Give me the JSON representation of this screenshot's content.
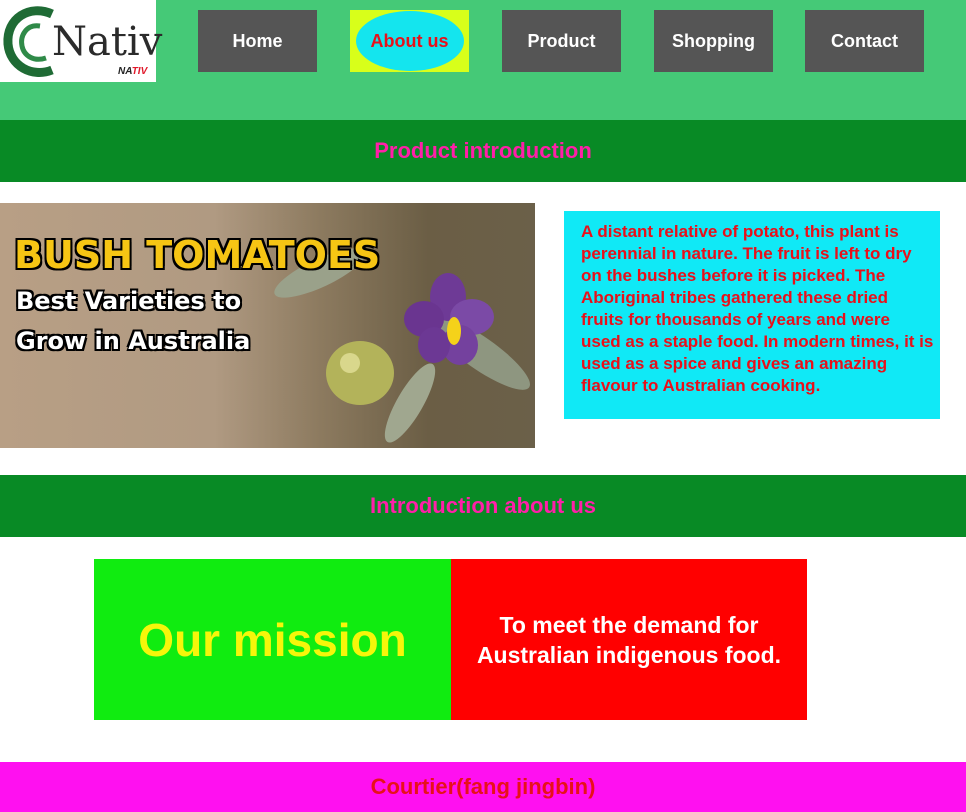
{
  "logo": {
    "brand": "Nativ",
    "sub_prefix": "NA",
    "sub_suffix": "TIV"
  },
  "nav": {
    "home": "Home",
    "about": "About us",
    "product": "Product",
    "shopping": "Shopping",
    "contact": "Contact"
  },
  "sections": {
    "product_intro": "Product introduction",
    "about_intro": "Introduction about us"
  },
  "hero": {
    "title": "BUSH TOMATOES",
    "line1": "Best Varieties to",
    "line2": "Grow in Australia"
  },
  "description": "A distant relative of potato, this plant is perennial in nature. The fruit is left to dry on the bushes before it is picked. The Aboriginal tribes gathered these dried fruits for thousands of years and were used as a staple food. In modern times, it is used as a spice and gives an amazing flavour to Australian cooking.",
  "mission": {
    "heading": "Our mission",
    "text": "To meet the demand for Australian indigenous food."
  },
  "footer": {
    "text": "Courtier(fang jingbin)"
  },
  "colors": {
    "header": "#45c977",
    "band": "#088a25",
    "band_text": "#ff1fa8",
    "nav_button": "#555555",
    "active_outer": "#d8ff1a",
    "active_inner": "#14e5ee",
    "description_bg": "#10e9f6",
    "mission_left": "#10ec10",
    "mission_right": "#ff0000",
    "footer": "#ff10f0"
  }
}
